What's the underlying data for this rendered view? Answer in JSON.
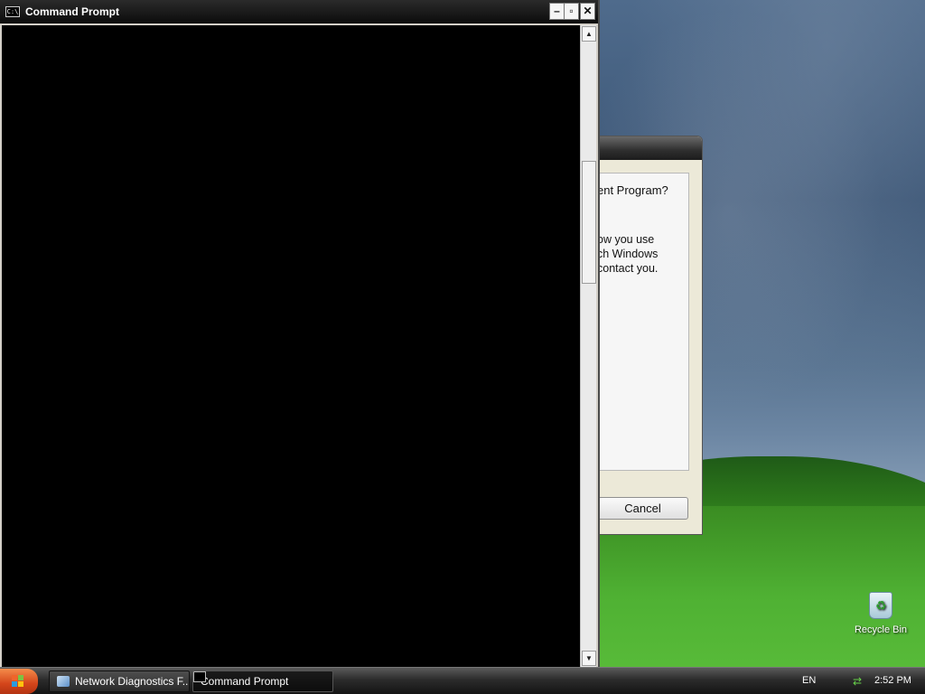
{
  "cmd_window": {
    "title": "Command Prompt",
    "icon_label": "C:\\",
    "controls": {
      "minimize": "–",
      "restore": "▫",
      "close": "✕"
    },
    "scroll": {
      "up": "▲",
      "down": "▼"
    }
  },
  "dialog": {
    "question_fragment": "ent Program?",
    "body_lines": [
      "ow you use",
      "ch Windows",
      "contact you."
    ],
    "cancel_label": "Cancel"
  },
  "desktop": {
    "recycle_bin_label": "Recycle Bin"
  },
  "taskbar": {
    "tasks": [
      {
        "label": "Network Diagnostics F...",
        "icon": "network-icon"
      },
      {
        "label": "Command Prompt",
        "icon": "cmd-icon"
      }
    ],
    "language": "EN",
    "time": "2:52 PM"
  },
  "colors": {
    "console_background": "#000000",
    "start_orange": "#d4451a"
  }
}
